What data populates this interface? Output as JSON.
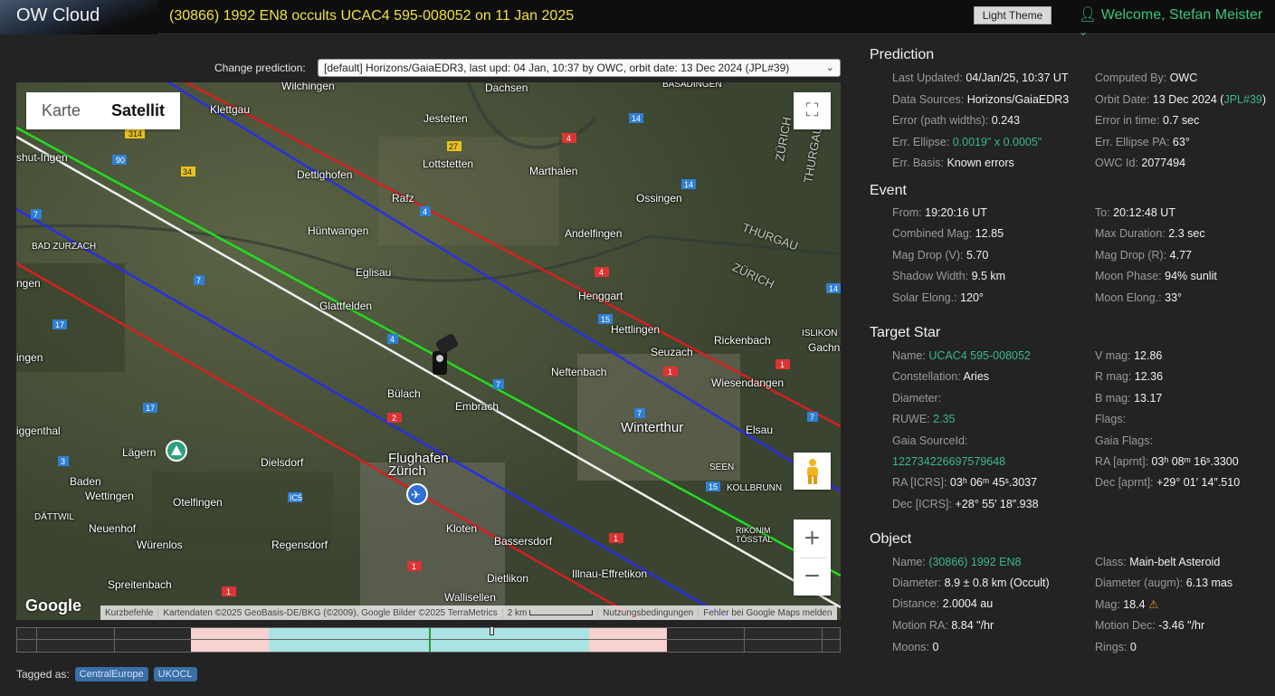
{
  "header": {
    "logo": "OW Cloud",
    "title": "(30866) 1992 EN8 occults UCAC4 595-008052 on 11 Jan 2025",
    "theme_button": "Light Theme",
    "welcome": "Welcome, Stefan Meister"
  },
  "prediction_select": {
    "label": "Change prediction:",
    "value": "[default] Horizons/GaiaEDR3, last upd: 04 Jan, 10:37 by OWC, orbit date: 13 Dec 2024 (JPL#39)"
  },
  "map": {
    "type_map": "Karte",
    "type_satellite": "Satellit",
    "google": "Google",
    "attribution": [
      "Kurzbefehle",
      "Kartendaten ©2025 GeoBasis-DE/BKG (©2009), Google Bilder ©2025 TerraMetrics",
      "2 km",
      "Nutzungsbedingungen",
      "Fehler bei Google Maps melden"
    ],
    "places": [
      "Wilchingen",
      "Dachsen",
      "BASADINGEN",
      "Klettgau",
      "Jestetten",
      "ZÜRICH",
      "THURGAU",
      "shut-Ingen",
      "Lottstetten",
      "Marthalen",
      "Dettighofen",
      "Rafz",
      "Ossingen",
      "BAD ZURZACH",
      "Hüntwangen",
      "Andelfingen",
      "THURGAU",
      "Eglisau",
      "ZÜRICH",
      "ngen",
      "Glattfelden",
      "Henggart",
      "Hettlingen",
      "Seuzach",
      "Rickenbach",
      "ISLIKON",
      "Gachn",
      "ingen",
      "Neftenbach",
      "Bülach",
      "Wiesendangen",
      "Embrach",
      "Winterthur",
      "iggenthal",
      "Lägern",
      "Dielsdorf",
      "Flughafen Zürich",
      "SEEN",
      "Baden",
      "Wettingen",
      "Otelfingen",
      "Elsau",
      "DÄTTWIL",
      "Neuenhof",
      "Regensdorf",
      "Kloten",
      "Bassersdorf",
      "Würenlos",
      "Spreitenbach",
      "Dietlikon",
      "Illnau-Effretikon",
      "Wallisellen",
      "KOLLBRUNN",
      "RIKONIM TÖSSTAL"
    ]
  },
  "tags": {
    "label": "Tagged as:",
    "items": [
      "CentralEurope",
      "UKOCL"
    ]
  },
  "prediction": {
    "title": "Prediction",
    "left": [
      {
        "label": "Last Updated:",
        "value": "04/Jan/25, 10:37 UT"
      },
      {
        "label": "Data Sources:",
        "value": "Horizons/GaiaEDR3"
      },
      {
        "label": "Error (path widths):",
        "value": "0.243"
      },
      {
        "label": "Err. Ellipse:",
        "value": "0.0019\" x 0.0005\"",
        "link": true
      },
      {
        "label": "Err. Basis:",
        "value": "Known errors"
      }
    ],
    "right": [
      {
        "label": "Computed By:",
        "value": "OWC"
      },
      {
        "label": "Orbit Date:",
        "value": "13 Dec 2024 (",
        "extra": "JPL#39",
        "tail": ")"
      },
      {
        "label": "Error in time:",
        "value": "0.7 sec"
      },
      {
        "label": "Err. Ellipse PA:",
        "value": "63°"
      },
      {
        "label": "OWC Id:",
        "value": "2077494"
      }
    ]
  },
  "event": {
    "title": "Event",
    "left": [
      {
        "label": "From:",
        "value": "19:20:16 UT"
      },
      {
        "label": "Combined Mag:",
        "value": "12.85"
      },
      {
        "label": "Mag Drop (V):",
        "value": "5.70"
      },
      {
        "label": "Shadow Width:",
        "value": "9.5 km"
      },
      {
        "label": "Solar Elong.:",
        "value": "120°"
      }
    ],
    "right": [
      {
        "label": "To:",
        "value": "20:12:48 UT"
      },
      {
        "label": "Max Duration:",
        "value": "2.3 sec"
      },
      {
        "label": "Mag Drop (R):",
        "value": "4.77"
      },
      {
        "label": "Moon Phase:",
        "value": "94% sunlit"
      },
      {
        "label": "Moon Elong.:",
        "value": "33°"
      }
    ]
  },
  "target_star": {
    "title": "Target Star",
    "name_label": "Name:",
    "name_value": "UCAC4 595-008052",
    "constellation_label": "Constellation:",
    "constellation_value": "Aries",
    "diameter_label": "Diameter:",
    "ruwe_label": "RUWE:",
    "ruwe_value": "2.35",
    "gaia_source_label": "Gaia SourceId:",
    "gaia_source_value": "12273422669757964​8",
    "ra_icrs_label": "RA [ICRS]:",
    "ra_icrs_value": "03ʰ 06ᵐ 45ˢ.3037",
    "dec_icrs_label": "Dec [ICRS]:",
    "dec_icrs_value": "+28° 55′ 18″.938",
    "vmag_label": "V mag:",
    "vmag_value": "12.86",
    "rmag_label": "R mag:",
    "rmag_value": "12.36",
    "bmag_label": "B mag:",
    "bmag_value": "13.17",
    "flags_label": "Flags:",
    "gaia_flags_label": "Gaia Flags:",
    "ra_aprnt_label": "RA [aprnt]:",
    "ra_aprnt_value": "03ʰ 08ᵐ 16ˢ.3300",
    "dec_aprnt_label": "Dec [aprnt]:",
    "dec_aprnt_value": "+29° 01′ 14″.510"
  },
  "object": {
    "title": "Object",
    "name_label": "Name:",
    "name_value": "(30866) 1992 EN8",
    "diameter_label": "Diameter:",
    "diameter_value": "8.9 ± 0.8 km",
    "diameter_note": "(Occult)",
    "distance_label": "Distance:",
    "distance_value": "2.0004 au",
    "motion_ra_label": "Motion RA:",
    "motion_ra_value": "8.84 \"/hr",
    "moons_label": "Moons:",
    "moons_value": "0",
    "class_label": "Class:",
    "class_value": "Main-belt Asteroid",
    "diam_augm_label": "Diameter (augm):",
    "diam_augm_value": "6.13 mas",
    "mag_label": "Mag:",
    "mag_value": "18.4",
    "motion_dec_label": "Motion Dec:",
    "motion_dec_value": "-3.46 \"/hr",
    "rings_label": "Rings:",
    "rings_value": "0"
  }
}
